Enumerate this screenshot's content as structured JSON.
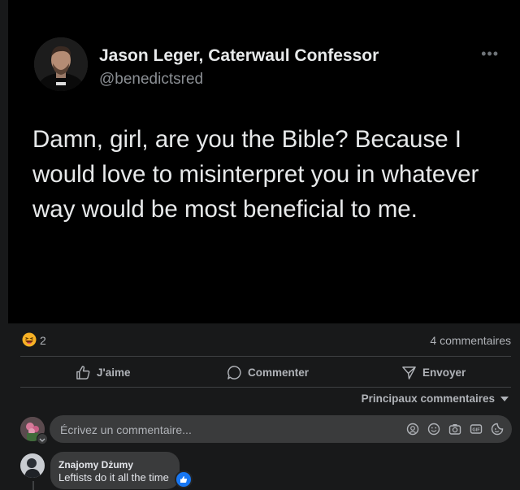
{
  "tweet": {
    "name": "Jason Leger, Caterwaul Confessor",
    "handle": "@benedictsred",
    "text": "Damn, girl, are you the Bible? Because I would love to misinterpret you in whatever way would be most beneficial to me.",
    "more_icon": "ellipsis-icon"
  },
  "stats": {
    "reaction_icon": "haha-emoji-icon",
    "reaction_count": "2",
    "comments_count": "4 commentaires"
  },
  "actions": {
    "like_label": "J'aime",
    "comment_label": "Commenter",
    "send_label": "Envoyer"
  },
  "sort": {
    "label": "Principaux commentaires"
  },
  "composer": {
    "placeholder": "Écrivez un commentaire...",
    "tools": [
      "avatar-sticker-icon",
      "emoji-icon",
      "camera-icon",
      "gif-icon",
      "sticker-icon"
    ]
  },
  "comment": {
    "author": "Znajomy Dżumy",
    "text": "Leftists do it all the time",
    "reaction_icon": "like-icon"
  },
  "colors": {
    "background": "#18191a",
    "tweet_background": "#000000",
    "bubble": "#3a3b3c",
    "secondary_text": "#b0b3b8",
    "like_blue": "#1877f2"
  }
}
